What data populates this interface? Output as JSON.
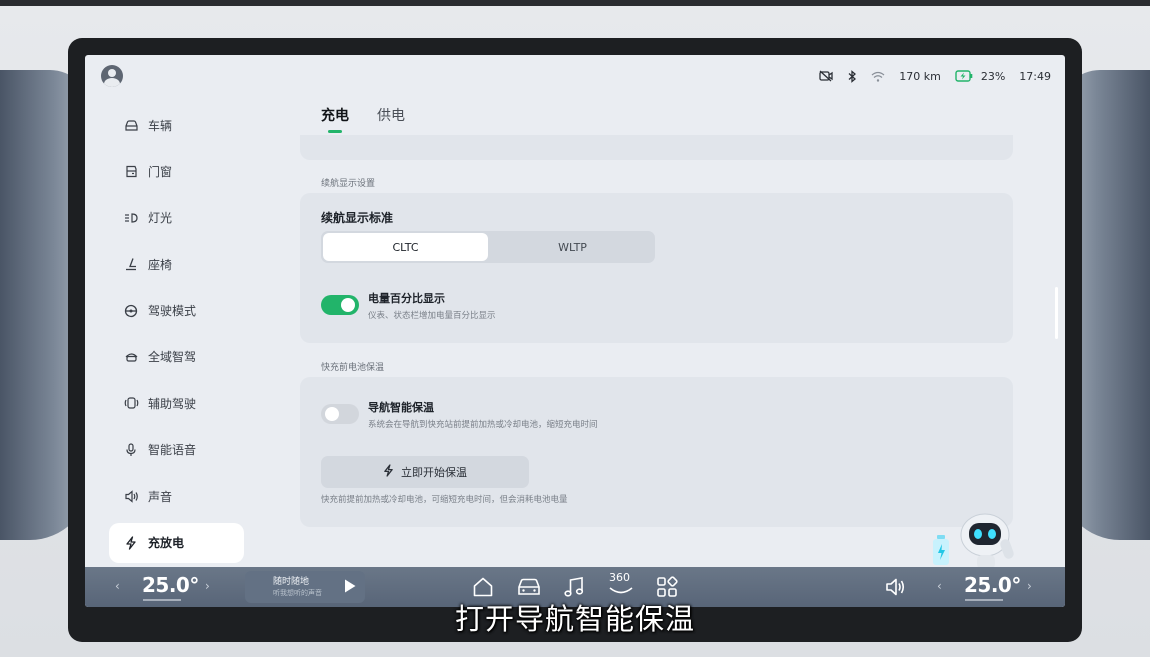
{
  "status_bar": {
    "range": "170 km",
    "battery_percent": "23%",
    "time": "17:49",
    "icons": [
      "camera-off-icon",
      "bluetooth-icon",
      "wifi-icon",
      "battery-charging-icon"
    ],
    "battery_color": "#22b46a"
  },
  "sidebar": {
    "items": [
      {
        "label": "车辆",
        "icon": "car-icon"
      },
      {
        "label": "门窗",
        "icon": "door-icon"
      },
      {
        "label": "灯光",
        "icon": "headlight-icon"
      },
      {
        "label": "座椅",
        "icon": "seat-icon"
      },
      {
        "label": "驾驶模式",
        "icon": "steering-wheel-icon"
      },
      {
        "label": "全域智驾",
        "icon": "autopilot-icon"
      },
      {
        "label": "辅助驾驶",
        "icon": "driver-assist-icon"
      },
      {
        "label": "智能语音",
        "icon": "microphone-icon"
      },
      {
        "label": "声音",
        "icon": "speaker-icon"
      },
      {
        "label": "充放电",
        "icon": "lightning-icon"
      }
    ],
    "active_index": 9
  },
  "tabs": [
    {
      "label": "充电",
      "active": true
    },
    {
      "label": "供电",
      "active": false
    }
  ],
  "range_section": {
    "label": "续航显示设置",
    "title": "续航显示标准",
    "options": [
      "CLTC",
      "WLTP"
    ],
    "selected": "CLTC",
    "battery_percent_toggle": {
      "title": "电量百分比显示",
      "desc": "仪表、状态栏增加电量百分比显示",
      "on": true
    }
  },
  "preheat_section": {
    "label": "快充前电池保温",
    "nav_toggle": {
      "title": "导航智能保温",
      "desc": "系统会在导航到快充站前提前加热或冷却电池，缩短充电时间",
      "on": false
    },
    "button_label": "立即开始保温",
    "footnote": "快充前提前加热或冷却电池，可缩短充电时间，但会消耗电池电量"
  },
  "dock": {
    "left_temp": "25.0°",
    "right_temp": "25.0°",
    "media_title": "随时随地",
    "media_sub": "听我想听的声音",
    "center_icons": [
      "home-icon",
      "car-front-icon",
      "music-icon",
      "view-360-icon",
      "apps-grid-icon"
    ],
    "label_360": "360"
  },
  "accent_color": "#22b46a",
  "subtitle": "打开导航智能保温"
}
